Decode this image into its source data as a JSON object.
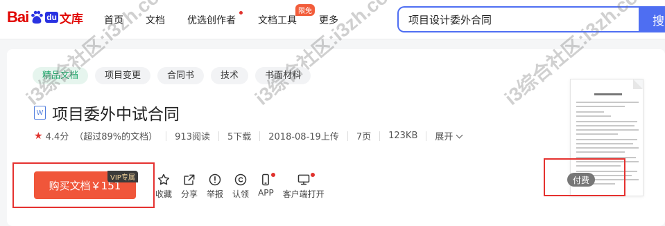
{
  "logo": {
    "bai": "Bai",
    "du": "du",
    "wenku": "文库"
  },
  "nav": {
    "items": [
      "首页",
      "文档",
      "优选创作者",
      "文档工具",
      "更多"
    ],
    "tool_badge": "限免"
  },
  "search": {
    "value": "项目设计委外合同",
    "button_label": "搜"
  },
  "tags": [
    "精品文档",
    "项目变更",
    "合同书",
    "技术",
    "书面材料"
  ],
  "doc": {
    "type_icon": "W",
    "title": "项目委外中试合同",
    "rating": "4.4分",
    "rating_note": "（超过89%的文档）",
    "reads": "913阅读",
    "downloads": "5下载",
    "uploaded": "2018-08-19上传",
    "pages": "7页",
    "size": "123KB",
    "expand": "展开"
  },
  "buy": {
    "label": "购买文档￥151",
    "vip_badge": "VIP专属"
  },
  "actions": [
    {
      "label": "收藏",
      "icon": "star-icon"
    },
    {
      "label": "分享",
      "icon": "share-icon"
    },
    {
      "label": "举报",
      "icon": "report-icon"
    },
    {
      "label": "认领",
      "icon": "copyright-icon"
    },
    {
      "label": "APP",
      "icon": "phone-icon"
    },
    {
      "label": "客户端打开",
      "icon": "monitor-icon"
    }
  ],
  "thumbnail": {
    "badge": "付费"
  },
  "watermark": "i3综合社区:i3zh.com",
  "colors": {
    "accent": "#4e6ef2",
    "buy": "#f0563a",
    "brand_red": "#e10602",
    "highlight_box": "#e5312f"
  }
}
